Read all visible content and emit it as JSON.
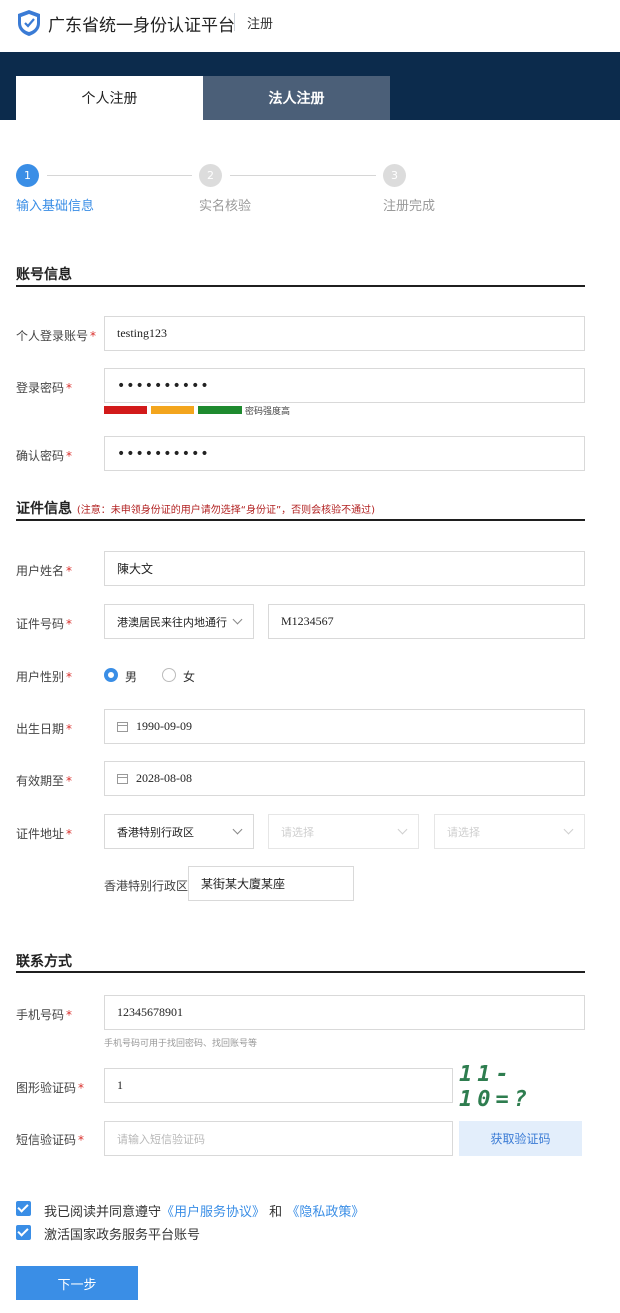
{
  "header": {
    "site_title": "广东省统一身份认证平台",
    "page_title": "注册"
  },
  "tabs": [
    {
      "label": "个人注册",
      "active": true
    },
    {
      "label": "法人注册",
      "active": false
    }
  ],
  "steps": [
    {
      "num": "1",
      "label": "输入基础信息",
      "active": true
    },
    {
      "num": "2",
      "label": "实名核验",
      "active": false
    },
    {
      "num": "3",
      "label": "注册完成",
      "active": false
    }
  ],
  "account": {
    "title": "账号信息",
    "login_label": "个人登录账号",
    "login_value": "testing123",
    "password_label": "登录密码",
    "password_value": "••••••••••",
    "strength_text": "密码强度高",
    "strength_colors": [
      "#d21a1a",
      "#f3a51d",
      "#1e8a2e"
    ],
    "confirm_label": "确认密码",
    "confirm_value": "••••••••••"
  },
  "certificate": {
    "title": "证件信息",
    "note": "(注意：未申领身份证的用户请勿选择“身份证”，否则会核验不通过)",
    "name_label": "用户姓名",
    "name_value": "陳大文",
    "idnum_label": "证件号码",
    "idtype_value": "港澳居民来往内地通行证",
    "idnum_value": "M1234567",
    "gender_label": "用户性别",
    "gender_options": [
      "男",
      "女"
    ],
    "gender_selected": "男",
    "birth_label": "出生日期",
    "birth_value": "1990-09-09",
    "expiry_label": "有效期至",
    "expiry_value": "2028-08-08",
    "address_label": "证件地址",
    "region_value": "香港特别行政区",
    "city_placeholder": "请选择",
    "district_placeholder": "请选择",
    "address_prefix": "香港特别行政区",
    "address_detail": "某街某大廈某座"
  },
  "contact": {
    "title": "联系方式",
    "phone_label": "手机号码",
    "phone_value": "12345678901",
    "phone_hint": "手机号码可用于找回密码、找回账号等",
    "captcha_label": "图形验证码",
    "captcha_value": "1",
    "captcha_image_text": "11-10=?",
    "sms_label": "短信验证码",
    "sms_placeholder": "请输入短信验证码",
    "sms_button": "获取验证码"
  },
  "agreement": {
    "text_pre": "我已阅读并同意遵守",
    "link1": "《用户服务协议》",
    "text_and": "和",
    "link2": "《隐私政策》",
    "activate_text": "激活国家政务服务平台账号"
  },
  "next_button": "下一步",
  "colors": {
    "brand_dark": "#0c2b4c",
    "accent": "#3a8ee6",
    "required": "#d9302c"
  }
}
